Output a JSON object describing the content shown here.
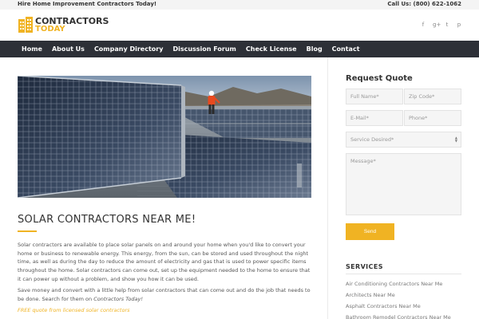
{
  "topbar": {
    "tagline": "Hire Home Improvement Contractors Today!",
    "phone": "Call Us: (800) 622-1062"
  },
  "header": {
    "logo_line1": "CONTRACTORS",
    "logo_line2": "TODAY",
    "social_icons": [
      "facebook-icon",
      "google-plus-icon",
      "twitter-icon",
      "pinterest-icon"
    ],
    "social_glyphs": [
      "f",
      "g+",
      "t",
      "p"
    ]
  },
  "nav": {
    "items": [
      {
        "label": "Home"
      },
      {
        "label": "About Us"
      },
      {
        "label": "Company Directory"
      },
      {
        "label": "Discussion Forum"
      },
      {
        "label": "Check License"
      },
      {
        "label": "Blog"
      },
      {
        "label": "Contact"
      }
    ]
  },
  "main": {
    "title": "SOLAR CONTRACTORS NEAR ME!",
    "paragraph1": "Solar contractors are available to place solar panels on and around your home when you'd like to convert your home or business to renewable energy. This energy, from the sun, can be stored and used throughout the night time, as well as during the day to reduce the amount of electricity and gas that is used to power specific items throughout the home. Solar contractors can come out, set up the equipment needed to the home to ensure that it can power up without a problem, and show you how it can be used.",
    "paragraph2_main": "Save money and convert with a little help from solar contractors that can come out and do the job that needs to be done. Search for them on ",
    "paragraph2_em": "Contractors Today!",
    "quote_link": "FREE quote from licensed solar contractors"
  },
  "sidebar": {
    "title": "Request Quote",
    "fields": {
      "full_name": "Full Name*",
      "zip": "Zip Code*",
      "email": "E-Mail*",
      "phone": "Phone*",
      "service": "Service Desired*",
      "message": "Message*"
    },
    "send_label": "Send",
    "services_title": "SERVICES",
    "services": [
      "Air Conditioning Contractors Near Me",
      "Architects Near Me",
      "Asphalt Contractors Near Me",
      "Bathroom Remodel Contractors Near Me"
    ]
  },
  "colors": {
    "accent": "#f0b323",
    "nav_bg": "#2d3037",
    "topbar_bg": "#f4f4f4"
  }
}
